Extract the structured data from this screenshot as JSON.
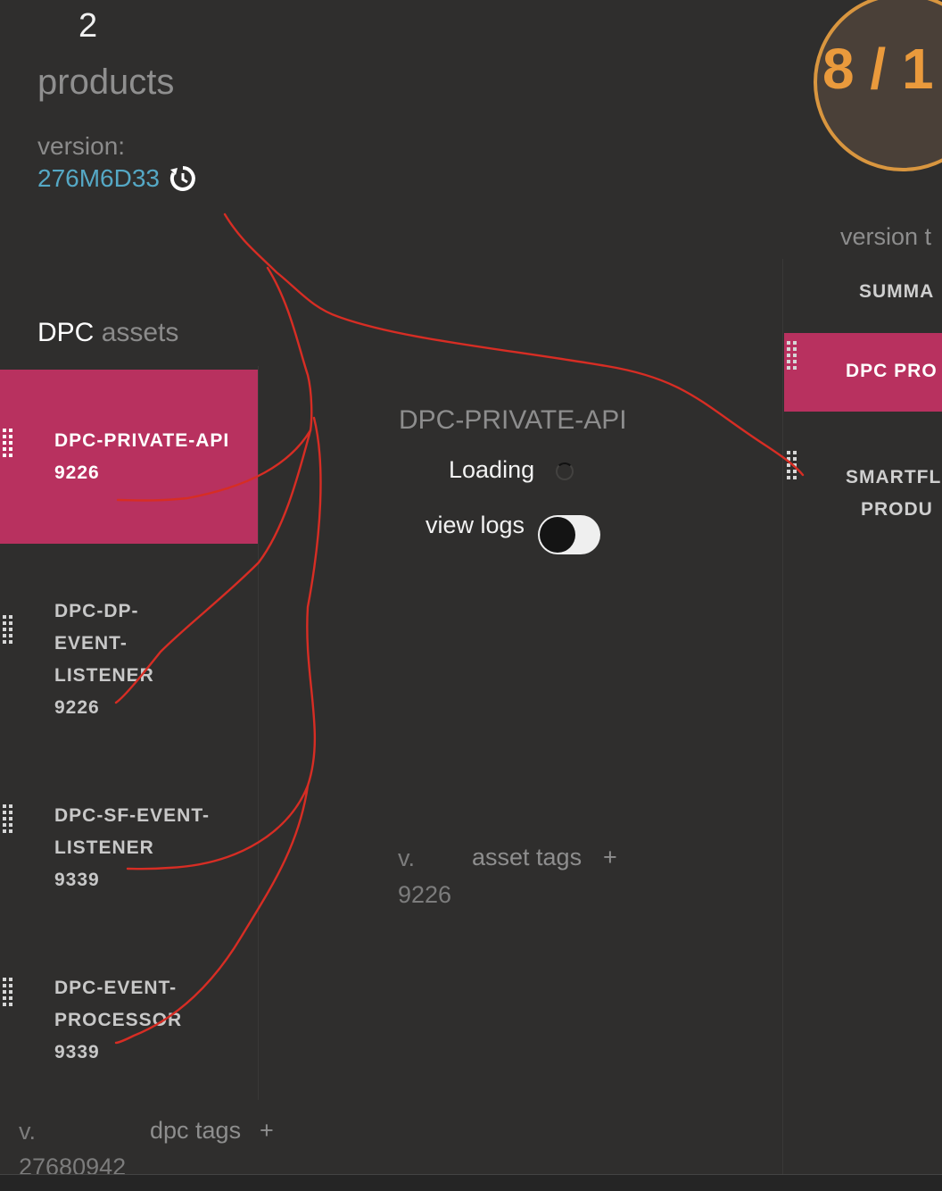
{
  "header": {
    "count": "2",
    "title": "products",
    "version_label": "version:",
    "version_value": "276M6D33"
  },
  "score": {
    "text": "8 / 1"
  },
  "assets": {
    "heading_strong": "DPC",
    "heading_muted": "assets",
    "items": [
      {
        "name": "DPC-PRIVATE-API",
        "version": "9226"
      },
      {
        "name": "DPC-DP-EVENT-LISTENER",
        "version": "9226"
      },
      {
        "name": "DPC-SF-EVENT-LISTENER",
        "version": "9339"
      },
      {
        "name": "DPC-EVENT-PROCESSOR",
        "version": "9339"
      }
    ]
  },
  "detail": {
    "title": "DPC-PRIVATE-API",
    "loading": "Loading",
    "view_logs": "view logs",
    "v_label": "v.",
    "version": "9226",
    "tags_label": "asset tags",
    "plus": "+"
  },
  "footer": {
    "v_label": "v.",
    "version": "27680942",
    "tags_label": "dpc tags",
    "plus": "+"
  },
  "right_panel": {
    "version_tabs_label": "version t",
    "tabs": [
      "SUMMA",
      "DPC PRO",
      "SMARTFL",
      "PRODU"
    ]
  }
}
